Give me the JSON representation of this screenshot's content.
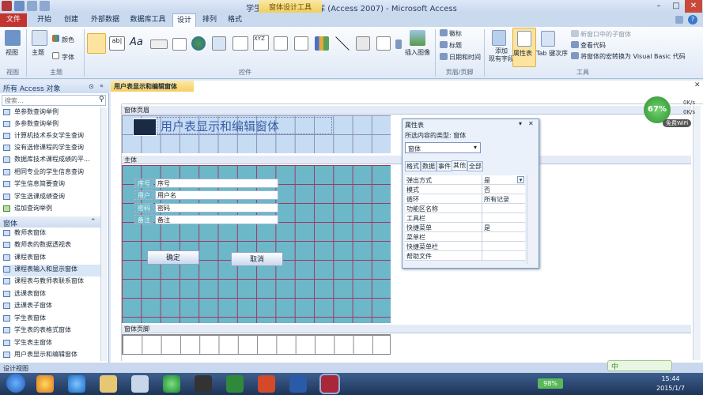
{
  "window": {
    "title": "学生成绩管理：数据库 (Access 2007) - Microsoft Access",
    "context_tools": "窗体设计工具"
  },
  "tabs": [
    "开始",
    "创建",
    "外部数据",
    "数据库工具",
    "设计",
    "排列",
    "格式"
  ],
  "file_tab": "文件",
  "ribbon": {
    "view": "视图",
    "theme": "主题",
    "colors": "颜色",
    "fonts": "字体",
    "insert_image": "插入图像",
    "header_logo": "徽标",
    "header_title": "标题",
    "header_datetime": "日期和时间",
    "add_fields": "添加\n现有字段",
    "property_sheet": "属性表",
    "tab_order": "Tab 键次序",
    "subform_new_window": "新窗口中的子窗体",
    "view_code": "查看代码",
    "convert_macros": "将窗体的宏转换为 Visual Basic 代码",
    "groups": {
      "views": "视图",
      "themes": "主题",
      "controls": "控件",
      "header_footer": "页眉/页脚",
      "tools": "工具"
    }
  },
  "nav": {
    "header": "所有 Access 对象",
    "search_placeholder": "搜索...",
    "query_items": [
      "单参数查询举例",
      "多参数查询举例",
      "计算机技术系女学生查询",
      "没有选修课程的学生查询",
      "数据库技术课程成绩的平...",
      "相同专业的学生信息查询",
      "学生信息简要查询",
      "学生选课成绩查询",
      "追加查询举例"
    ],
    "forms_category": "窗体",
    "form_items": [
      "教师表窗体",
      "教师表的数据透视表",
      "课程表窗体",
      "课程表输入和显示窗体",
      "课程表与教师表联系窗体",
      "选课表窗体",
      "选课表子窗体",
      "学生表窗体",
      "学生表的表格式窗体",
      "学生表主窗体",
      "用户表显示和编辑窗体"
    ]
  },
  "document": {
    "tab_title": "用户表显示和编辑窗体",
    "sections": {
      "header": "窗体页眉",
      "detail": "主体",
      "footer": "窗体页脚"
    },
    "form_title": "用户表显示和编辑窗体",
    "fields": [
      {
        "label": "序号",
        "value": "序号"
      },
      {
        "label": "用户",
        "value": "用户名"
      },
      {
        "label": "密码",
        "value": "密码"
      },
      {
        "label": "备注",
        "value": "备注"
      }
    ],
    "ok_button": "确定",
    "cancel_button": "取消"
  },
  "property_sheet": {
    "title": "属性表",
    "selection_type_label": "所选内容的类型: 窗体",
    "selected_object": "窗体",
    "tabs": [
      "格式",
      "数据",
      "事件",
      "其他",
      "全部"
    ],
    "rows": [
      {
        "key": "弹出方式",
        "value": "是"
      },
      {
        "key": "模式",
        "value": "否"
      },
      {
        "key": "循环",
        "value": "所有记录"
      },
      {
        "key": "功能区名称",
        "value": ""
      },
      {
        "key": "工具栏",
        "value": ""
      },
      {
        "key": "快捷菜单",
        "value": "是"
      },
      {
        "key": "菜单栏",
        "value": ""
      },
      {
        "key": "快捷菜单栏",
        "value": ""
      },
      {
        "key": "帮助文件",
        "value": ""
      }
    ]
  },
  "status": "设计视图",
  "network": {
    "percent": "67%",
    "up": "0K/s",
    "down": "0K/s",
    "wifi": "免费WiFi"
  },
  "ime": "中",
  "tray": {
    "battery": "98%",
    "time": "15:44",
    "date": "2015/1/7"
  },
  "colors": {
    "accent": "#c1342f",
    "detail_bg": "#6cb7c8",
    "grid_line": "#a0396a"
  }
}
